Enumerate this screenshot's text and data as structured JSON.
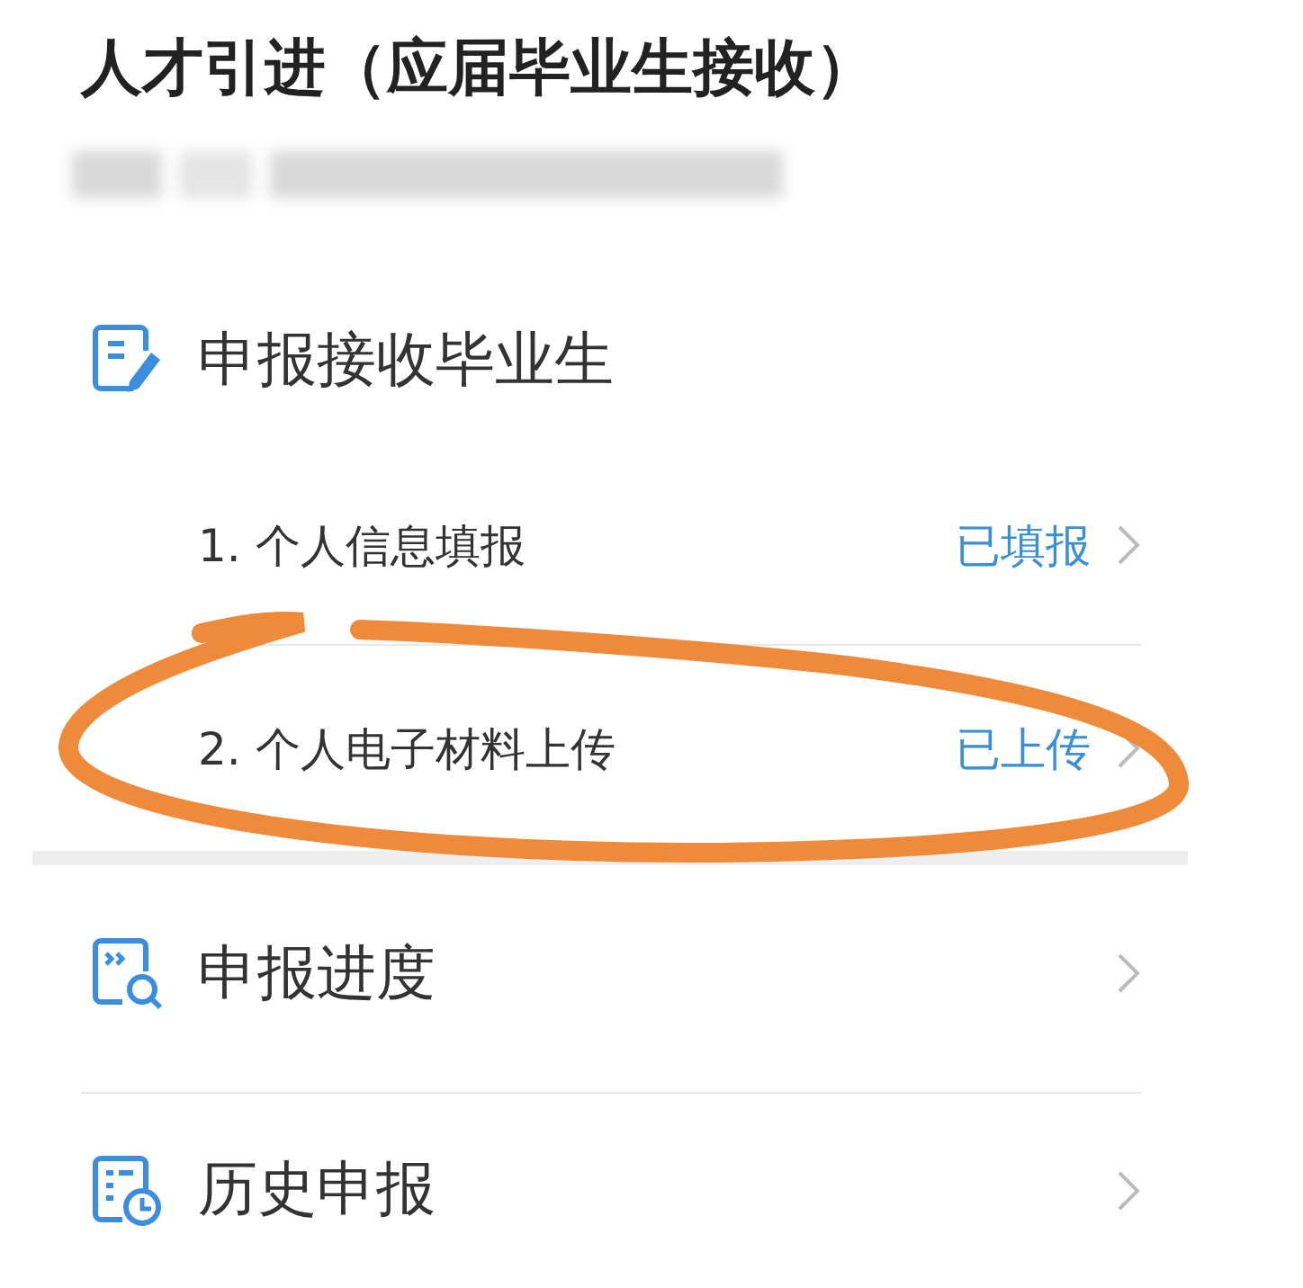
{
  "title": "人才引进（应届毕业生接收）",
  "sections": [
    {
      "kind": "group",
      "title": "申报接收毕业生",
      "items": [
        {
          "label": "1. 个人信息填报",
          "status": "已填报"
        },
        {
          "label": "2. 个人电子材料上传",
          "status": "已上传"
        }
      ]
    },
    {
      "kind": "link",
      "title": "申报进度"
    },
    {
      "kind": "link",
      "title": "历史申报"
    }
  ]
}
